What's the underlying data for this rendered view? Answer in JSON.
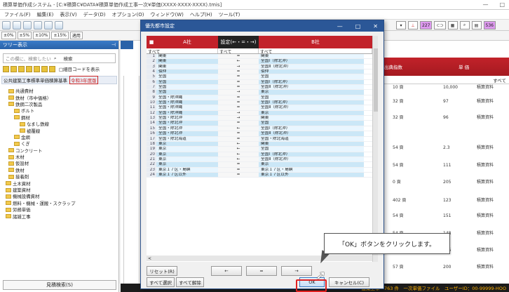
{
  "app": {
    "title": "積算単価作成システム - [C:¥積算C¥DATA¥積算単価作成工事一次¥単価(XXXX-XXXX-XXXX).tmis]",
    "menu": [
      "ファイル(F)",
      "編集(E)",
      "表示(V)",
      "データ(D)",
      "オプション(O)",
      "ウィンドウ(W)",
      "ヘルプ(H)",
      "ツール(T)"
    ],
    "percent_buttons": [
      "±0%",
      "±5%",
      "±10%",
      "±15%",
      "適用"
    ],
    "right_tools": [
      "227",
      "536"
    ]
  },
  "left_pane": {
    "header": "ツリー表示",
    "search_placeholder": "この欄に、検索したい",
    "search_button": "検索",
    "code_checkbox": "□細目コードを表示",
    "category": "公共建築工事標準単価積算基準",
    "category_badge": "令和3年度版",
    "tree": [
      "共通費材",
      "鉄材（市中価格）",
      "鉄鋼二次製品",
      "ボルト",
      "鋼材",
      "なまし鉄線",
      "被覆線",
      "金網",
      "くぎ",
      "コンクリート",
      "木材",
      "仮設材",
      "鉄材",
      "接着剤",
      "土木資材",
      "建築資材",
      "機械設備資材",
      "燃料・機械・運搬・スクラップ",
      "労務単価",
      "諸雑工事"
    ],
    "bottom_button": "見積検索(S)"
  },
  "background": {
    "right_header_left": "出典指数",
    "right_header_right": "単 価",
    "right_sub": "すべて",
    "cells": [
      [
        "10 頁",
        "10,000",
        "積算資料"
      ],
      [
        "32 頁",
        "97",
        "積算資料"
      ],
      [
        "32 頁",
        "96",
        "積算資料"
      ],
      [
        "54 頁",
        "2.3",
        "積算資料"
      ],
      [
        "54 頁",
        "111",
        "積算資料"
      ],
      [
        "0 頁",
        "205",
        "積算資料"
      ],
      [
        "402 頁",
        "123",
        "積算資料"
      ],
      [
        "54 頁",
        "151",
        "積算資料"
      ],
      [
        "54 頁",
        "148",
        "積算資料"
      ],
      [
        "",
        "205",
        "積算資料"
      ],
      [
        "57 頁",
        "200",
        "積算資料"
      ]
    ],
    "status": "建築工事　763 件　一次単価ファイル　ユーザーID：00-99999-HOO"
  },
  "dialog": {
    "title": "優先都市設定",
    "col_a": "A社",
    "col_setting": "設定(←・=・→)",
    "col_b": "B社",
    "filter_a": "すべて",
    "filter_s": "すべて",
    "filter_b": "すべて",
    "rows": [
      [
        "1",
        "関東",
        "=",
        "関東"
      ],
      [
        "2",
        "関東",
        "←",
        "全国Ⅰ（除北沖）"
      ],
      [
        "3",
        "関東",
        "→",
        "全国Ⅱ（除北沖）"
      ],
      [
        "4",
        "伯仲",
        "=",
        "伯仲"
      ],
      [
        "5",
        "全国",
        "=",
        "全国"
      ],
      [
        "6",
        "全国",
        "=",
        "全国Ⅰ（除北沖）"
      ],
      [
        "7",
        "全国",
        "=",
        "全国Ⅱ（除北沖）"
      ],
      [
        "8",
        "全国",
        "→",
        "東京"
      ],
      [
        "9",
        "全国・除沖縄",
        "=",
        "全国"
      ],
      [
        "10",
        "全国・除沖縄",
        "=",
        "全国Ⅰ（除北沖）"
      ],
      [
        "11",
        "全国・除沖縄",
        "=",
        "全国Ⅱ（除北沖）"
      ],
      [
        "12",
        "全国・除沖縄",
        "→",
        "東京"
      ],
      [
        "13",
        "全国・除北沖",
        "→",
        "関東"
      ],
      [
        "14",
        "全国・除北沖",
        "=",
        "全国"
      ],
      [
        "15",
        "全国・除北沖",
        "←",
        "全国Ⅰ（除北沖）"
      ],
      [
        "16",
        "全国・除北沖",
        "=",
        "全国Ⅱ（除北沖）"
      ],
      [
        "17",
        "全国・除北海道",
        "=",
        "全国・除北海道"
      ],
      [
        "18",
        "東京",
        "←",
        "関東"
      ],
      [
        "19",
        "東京",
        "←",
        "全国"
      ],
      [
        "20",
        "東京",
        "←",
        "全国Ⅰ（除北沖）"
      ],
      [
        "21",
        "東京",
        "←",
        "全国Ⅱ（除北沖）"
      ],
      [
        "22",
        "東京",
        "=",
        "東京"
      ],
      [
        "23",
        "東京１７区・島嶼",
        "=",
        "東京１７区・島嶼"
      ],
      [
        "24",
        "東京１７区以外",
        "=",
        "東京１７区以外"
      ]
    ],
    "reset_button": "リセット(R)",
    "btn_left": "←",
    "btn_equal": "=",
    "btn_right": "→",
    "select_all_button": "すべて選択",
    "deselect_all_button": "すべて解除",
    "ok_button": "OK",
    "cancel_button": "キャンセル(C)"
  },
  "callout": {
    "text": "「OK」ボタンをクリックします。"
  },
  "colors": {
    "dialog_title": "#2b5797",
    "col_a": "#c2222a",
    "col_b": "#c2222a",
    "col_setting": "#222222",
    "highlight": "#e02020"
  }
}
